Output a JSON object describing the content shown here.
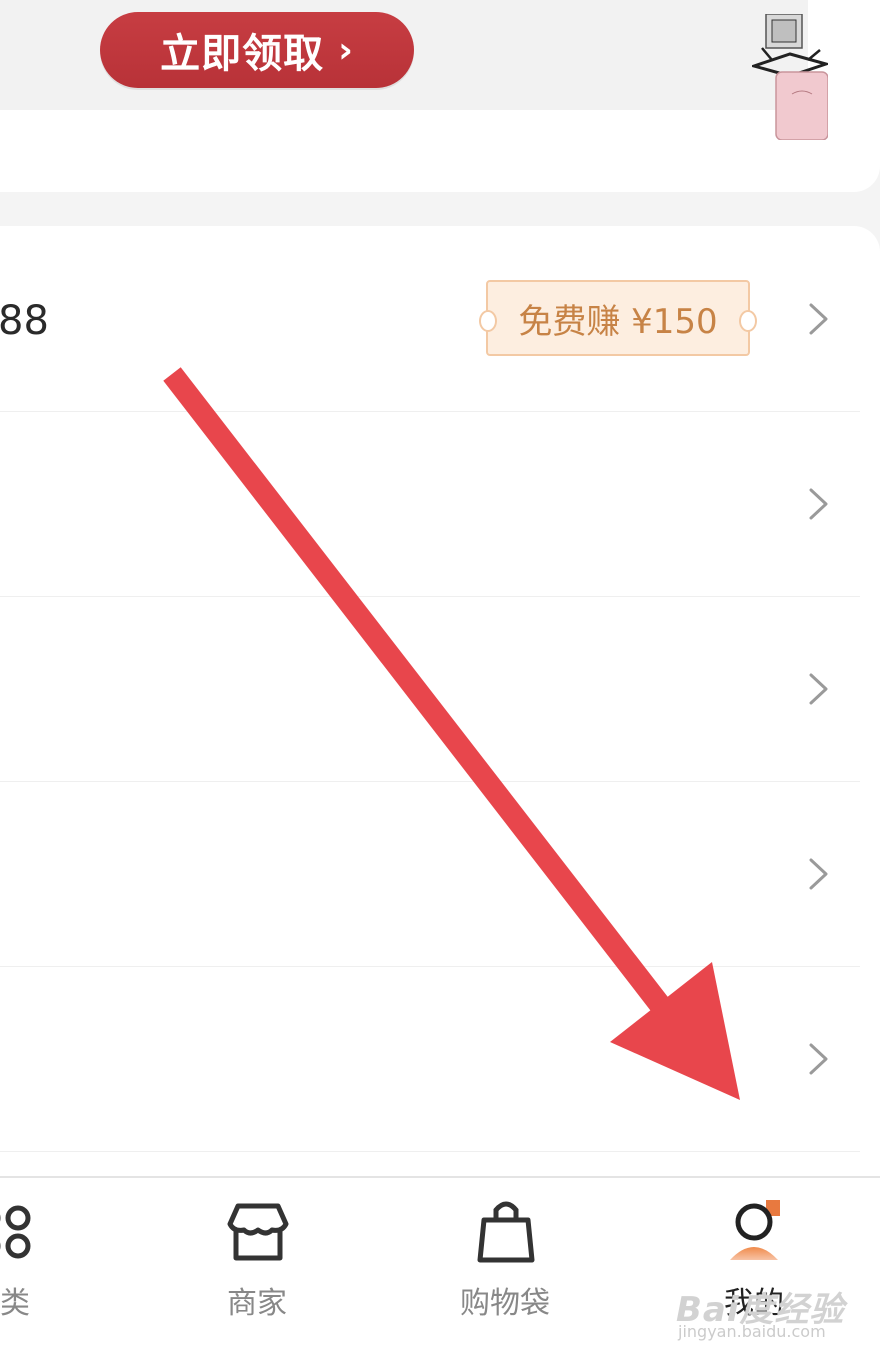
{
  "promo": {
    "claim_label": "立即领取",
    "claim_chevron": "›"
  },
  "menu": {
    "rows": [
      {
        "value": "88",
        "badge": "免费赚 ¥150",
        "chevron": "chevron-right-icon"
      },
      {
        "value": "",
        "chevron": "chevron-right-icon"
      },
      {
        "value": "",
        "chevron": "chevron-right-icon"
      },
      {
        "value": "",
        "chevron": "chevron-right-icon"
      },
      {
        "value": "",
        "chevron": "chevron-right-icon"
      }
    ]
  },
  "tabbar": {
    "tabs": [
      {
        "label": "分类",
        "icon": "category-grid-icon",
        "active": false
      },
      {
        "label": "商家",
        "icon": "store-icon",
        "active": false
      },
      {
        "label": "购物袋",
        "icon": "shopping-bag-icon",
        "active": false
      },
      {
        "label": "我的",
        "icon": "profile-icon",
        "active": true
      }
    ]
  },
  "colors": {
    "accent_red": "#c0393e",
    "badge_bg": "#fdeee0",
    "badge_text": "#c78346",
    "active_profile": "#e8793f",
    "arrow": "#e8464c"
  },
  "watermark": {
    "brand": "Bai度经验",
    "url": "jingyan.baidu.com"
  }
}
